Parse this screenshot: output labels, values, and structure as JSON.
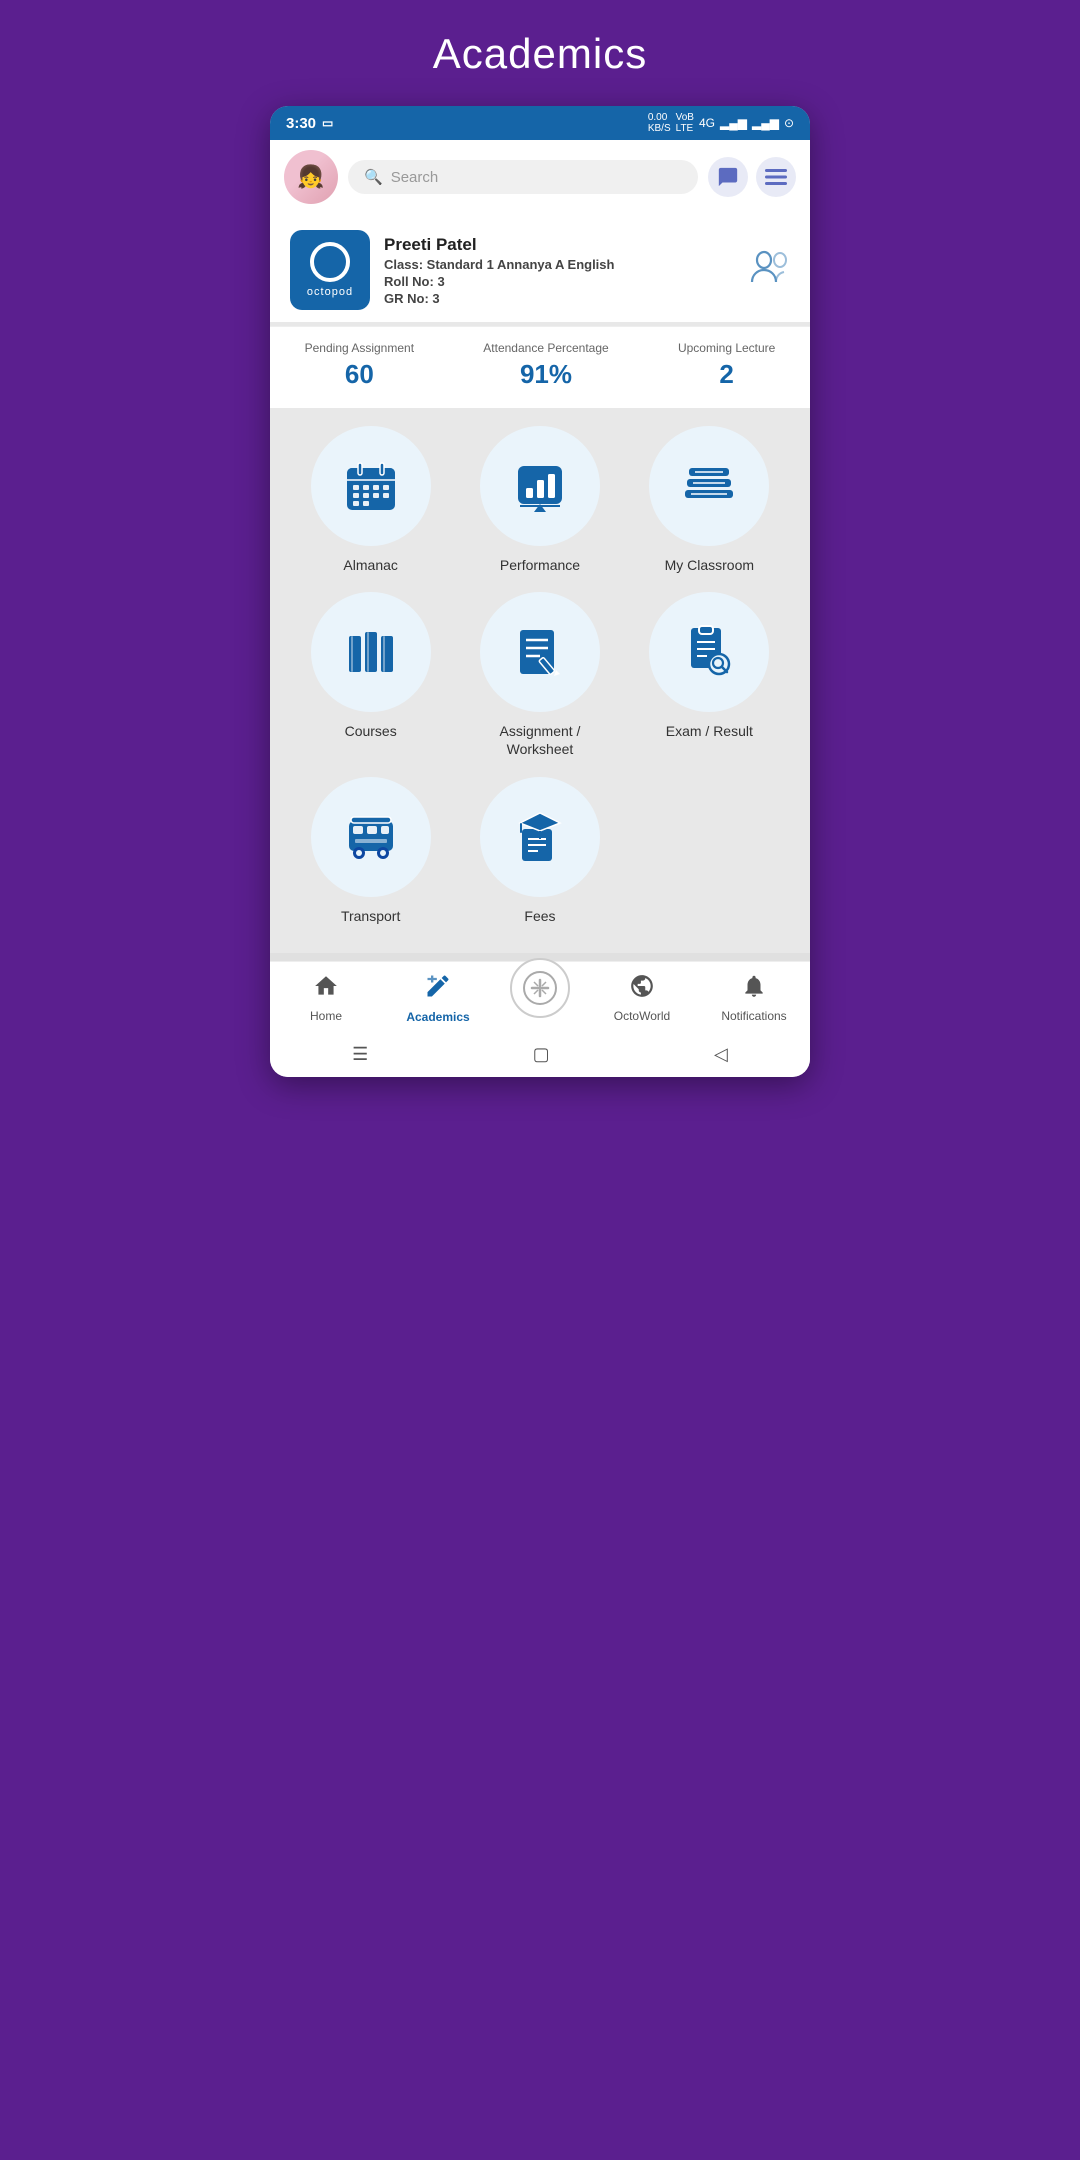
{
  "page": {
    "title": "Academics"
  },
  "status_bar": {
    "time": "3:30",
    "network": "4G",
    "battery": "⊙"
  },
  "header": {
    "search_placeholder": "Search",
    "chat_icon": "💬",
    "menu_icon": "☰"
  },
  "profile": {
    "logo_text": "octopod",
    "name": "Preeti Patel",
    "class_label": "Class:",
    "class_value": "Standard 1 Annanya A English",
    "roll_label": "Roll No:",
    "roll_value": "3",
    "gr_label": "GR No:",
    "gr_value": "3"
  },
  "stats": [
    {
      "label": "Pending Assignment",
      "value": "60"
    },
    {
      "label": "Attendance Percentage",
      "value": "91%"
    },
    {
      "label": "Upcoming Lecture",
      "value": "2"
    }
  ],
  "grid": [
    [
      {
        "id": "almanac",
        "label": "Almanac",
        "icon": "calendar"
      },
      {
        "id": "performance",
        "label": "Performance",
        "icon": "chart"
      },
      {
        "id": "my-classroom",
        "label": "My Classroom",
        "icon": "books-stack"
      }
    ],
    [
      {
        "id": "courses",
        "label": "Courses",
        "icon": "books"
      },
      {
        "id": "assignment-worksheet",
        "label": "Assignment / Worksheet",
        "icon": "assignment"
      },
      {
        "id": "exam-result",
        "label": "Exam / Result",
        "icon": "exam"
      }
    ],
    [
      {
        "id": "transport",
        "label": "Transport",
        "icon": "bus"
      },
      {
        "id": "fees",
        "label": "Fees",
        "icon": "fees"
      },
      {
        "id": "empty",
        "label": "",
        "icon": "empty"
      }
    ]
  ],
  "bottom_nav": [
    {
      "id": "home",
      "label": "Home",
      "icon": "🏠",
      "active": false
    },
    {
      "id": "academics",
      "label": "Academics",
      "icon": "✏️",
      "active": true
    },
    {
      "id": "octoworld-center",
      "label": "",
      "icon": "⊕",
      "active": false
    },
    {
      "id": "octoworld",
      "label": "OctoWorld",
      "icon": "🌐",
      "active": false
    },
    {
      "id": "notifications",
      "label": "Notifications",
      "icon": "🔔",
      "active": false
    }
  ]
}
